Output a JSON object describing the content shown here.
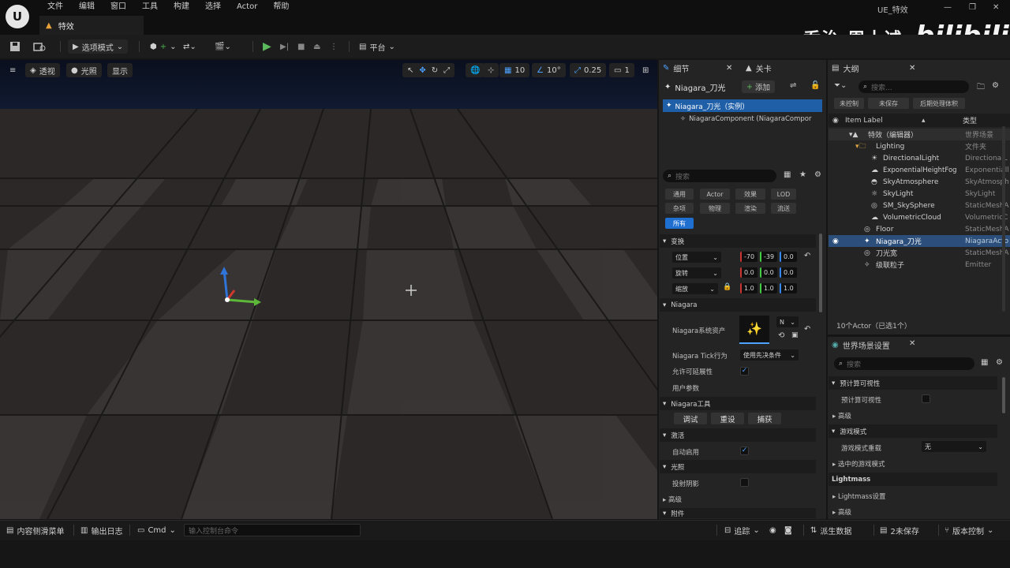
{
  "menu": [
    "文件",
    "编辑",
    "窗口",
    "工具",
    "构建",
    "选择",
    "Actor",
    "帮助"
  ],
  "tab_title": "特效",
  "window_title": "UE_特效",
  "watermark": {
    "text": "乔治-周士诚",
    "brand": "bilibili"
  },
  "toolbar": {
    "mode": "选项模式",
    "platform": "平台"
  },
  "viewport": {
    "perspective": "透视",
    "lit": "光照",
    "show": "显示",
    "grid_snap": "10",
    "rot_snap": "10°",
    "scale_snap": "0.25",
    "cam_speed": "1"
  },
  "details": {
    "tab": "细节",
    "tab2": "关卡",
    "actor_name": "Niagara_刀光",
    "add": "添加",
    "instance": "Niagara_刀光（实例）",
    "component": "NiagaraComponent (NiagaraCompor",
    "search_placeholder": "搜索",
    "filters": [
      "通用",
      "Actor",
      "效果",
      "LOD",
      "杂项",
      "物理",
      "渲染",
      "流送",
      "所有"
    ],
    "transform": "变换",
    "location": "位置",
    "rotation": "旋转",
    "scale": "缩放",
    "loc_vals": [
      "-70",
      "-39",
      "0.0"
    ],
    "rot_vals": [
      "0.0",
      "0.0",
      "0.0"
    ],
    "scale_vals": [
      "1.0",
      "1.0",
      "1.0"
    ],
    "niagara": "Niagara",
    "system_asset": "Niagara系统资产",
    "asset_short": "N",
    "tick_behavior": "Niagara Tick行为",
    "tick_value": "使用先决条件",
    "allow_scalability": "允许可延展性",
    "user_params": "用户参数",
    "niagara_tools": "Niagara工具",
    "debug": "调试",
    "reset": "重设",
    "capture": "捕获",
    "activation": "激活",
    "auto_activate": "自动启用",
    "lighting": "光照",
    "cast_shadow": "投射阴影",
    "advanced": "高级",
    "attachment": "附件"
  },
  "outliner": {
    "tab": "大纲",
    "search_placeholder": "搜索...",
    "btns": [
      "未控制",
      "未保存",
      "后期处理体积"
    ],
    "col_label": "Item Label",
    "col_type": "类型",
    "items": [
      {
        "name": "特效（编辑器）",
        "type": "世界场景"
      },
      {
        "name": "Lighting",
        "type": "文件夹"
      },
      {
        "name": "DirectionalLight",
        "type": "DirectionalL"
      },
      {
        "name": "ExponentialHeightFog",
        "type": "Exponentiall"
      },
      {
        "name": "SkyAtmosphere",
        "type": "SkyAtmosph"
      },
      {
        "name": "SkyLight",
        "type": "SkyLight"
      },
      {
        "name": "SM_SkySphere",
        "type": "StaticMeshA"
      },
      {
        "name": "VolumetricCloud",
        "type": "VolumetricC"
      },
      {
        "name": "Floor",
        "type": "StaticMeshA"
      },
      {
        "name": "Niagara_刀光",
        "type": "NiagaraActo"
      },
      {
        "name": "刀光宽",
        "type": "StaticMeshA"
      },
      {
        "name": "级联粒子",
        "type": "Emitter"
      }
    ],
    "count": "10个Actor（已选1个）"
  },
  "world_settings": {
    "tab": "世界场景设置",
    "search_placeholder": "搜索",
    "precomputed_vis": "预计算可视性",
    "precomputed_vis2": "预计算可视性",
    "advanced": "高级",
    "game_mode": "游戏模式",
    "gm_override": "游戏模式重载",
    "gm_value": "无",
    "selected_gm": "选中的游戏模式",
    "lightmass": "Lightmass",
    "lightmass_settings": "Lightmass设置",
    "advanced2": "高级"
  },
  "bottom": {
    "content_drawer": "内容侧滑菜单",
    "output_log": "输出日志",
    "cmd": "Cmd",
    "console_placeholder": "输入控制台命令",
    "trace": "追踪",
    "derived": "派生数据",
    "unsaved": "2未保存",
    "revision": "版本控制"
  }
}
